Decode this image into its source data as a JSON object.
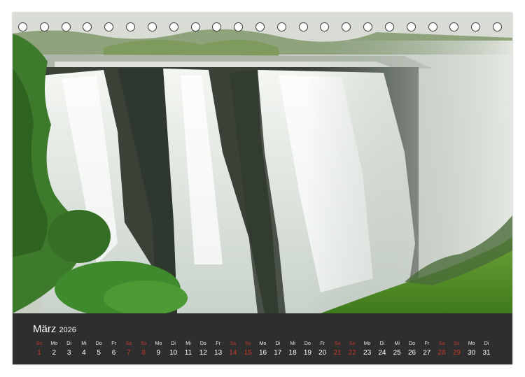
{
  "calendar": {
    "month": "März",
    "year": "2026",
    "days": [
      {
        "wd": "So",
        "d": "1",
        "weekend": true
      },
      {
        "wd": "Mo",
        "d": "2",
        "weekend": false
      },
      {
        "wd": "Di",
        "d": "3",
        "weekend": false
      },
      {
        "wd": "Mi",
        "d": "4",
        "weekend": false
      },
      {
        "wd": "Do",
        "d": "5",
        "weekend": false
      },
      {
        "wd": "Fr",
        "d": "6",
        "weekend": false
      },
      {
        "wd": "Sa",
        "d": "7",
        "weekend": true
      },
      {
        "wd": "So",
        "d": "8",
        "weekend": true
      },
      {
        "wd": "Mo",
        "d": "9",
        "weekend": false
      },
      {
        "wd": "Di",
        "d": "10",
        "weekend": false
      },
      {
        "wd": "Mi",
        "d": "11",
        "weekend": false
      },
      {
        "wd": "Do",
        "d": "12",
        "weekend": false
      },
      {
        "wd": "Fr",
        "d": "13",
        "weekend": false
      },
      {
        "wd": "Sa",
        "d": "14",
        "weekend": true
      },
      {
        "wd": "So",
        "d": "15",
        "weekend": true
      },
      {
        "wd": "Mo",
        "d": "16",
        "weekend": false
      },
      {
        "wd": "Di",
        "d": "17",
        "weekend": false
      },
      {
        "wd": "Mi",
        "d": "18",
        "weekend": false
      },
      {
        "wd": "Do",
        "d": "19",
        "weekend": false
      },
      {
        "wd": "Fr",
        "d": "20",
        "weekend": false
      },
      {
        "wd": "Sa",
        "d": "21",
        "weekend": true
      },
      {
        "wd": "So",
        "d": "22",
        "weekend": true
      },
      {
        "wd": "Mo",
        "d": "23",
        "weekend": false
      },
      {
        "wd": "Di",
        "d": "24",
        "weekend": false
      },
      {
        "wd": "Mi",
        "d": "25",
        "weekend": false
      },
      {
        "wd": "Do",
        "d": "26",
        "weekend": false
      },
      {
        "wd": "Fr",
        "d": "27",
        "weekend": false
      },
      {
        "wd": "Sa",
        "d": "28",
        "weekend": true
      },
      {
        "wd": "So",
        "d": "29",
        "weekend": true
      },
      {
        "wd": "Mo",
        "d": "30",
        "weekend": false
      },
      {
        "wd": "Di",
        "d": "31",
        "weekend": false
      }
    ]
  },
  "binding": {
    "ring_count": 23
  },
  "colors": {
    "weekend": "#c0392b",
    "footer": "#2e2e2e",
    "text": "#ffffff"
  }
}
